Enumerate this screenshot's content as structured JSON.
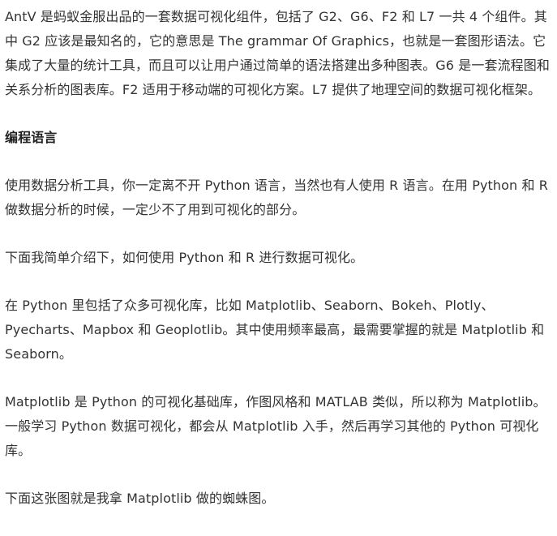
{
  "article": {
    "paragraphs": [
      {
        "type": "text",
        "text": "AntV 是蚂蚁金服出品的一套数据可视化组件，包括了 G2、G6、F2 和 L7 一共 4 个组件。其中 G2 应该是最知名的，它的意思是 The grammar Of Graphics，也就是一套图形语法。它集成了大量的统计工具，而且可以让用户通过简单的语法搭建出多种图表。G6 是一套流程图和关系分析的图表库。F2 适用于移动端的可视化方案。L7 提供了地理空间的数据可视化框架。"
      },
      {
        "type": "heading",
        "text": "编程语言"
      },
      {
        "type": "text",
        "text": "使用数据分析工具，你一定离不开 Python 语言，当然也有人使用 R 语言。在用 Python 和 R 做数据分析的时候，一定少不了用到可视化的部分。"
      },
      {
        "type": "text",
        "text": "下面我简单介绍下，如何使用 Python 和 R 进行数据可视化。"
      },
      {
        "type": "text",
        "text": "在 Python 里包括了众多可视化库，比如 Matplotlib、Seaborn、Bokeh、Plotly、Pyecharts、Mapbox 和 Geoplotlib。其中使用频率最高，最需要掌握的就是 Matplotlib 和 Seaborn。"
      },
      {
        "type": "text",
        "text": "Matplotlib 是 Python 的可视化基础库，作图风格和 MATLAB 类似，所以称为 Matplotlib。一般学习 Python 数据可视化，都会从 Matplotlib 入手，然后再学习其他的 Python 可视化库。"
      },
      {
        "type": "text",
        "text": "下面这张图就是我拿 Matplotlib 做的蜘蛛图。"
      }
    ]
  }
}
